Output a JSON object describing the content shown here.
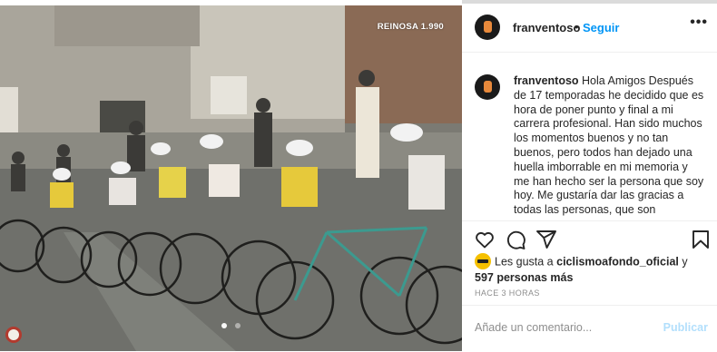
{
  "photo": {
    "watermark": "REINOSA 1.990",
    "stamp_icon": "circular-stamp-logo",
    "carousel_dots": 2
  },
  "post": {
    "username": "franventoso",
    "separator": "•",
    "follow_label": "Seguir",
    "more_label": "•••",
    "caption_user": "franventoso",
    "caption_text": "Hola Amigos Después de 17 temporadas he decidido que es hora de poner punto y final a mi carrera profesional. Han sido muchos los momentos buenos y no tan buenos, pero todos han dejado una huella imborrable en mi memoria y me han hecho ser la persona que soy hoy. Me gustaría dar las gracias a todas las personas, que son",
    "likes_prefix": "Les gusta a",
    "likes_user": "ciclismoafondo_oficial",
    "likes_and": "y",
    "likes_count": "597 personas más",
    "timestamp": "HACE 3 HORAS",
    "comment_placeholder": "Añade un comentario...",
    "publish_label": "Publicar"
  },
  "icons": [
    "heart-icon",
    "comment-icon",
    "share-icon",
    "bookmark-icon"
  ],
  "colors": {
    "accent": "#0095f6",
    "publish_disabled": "#b2dffc",
    "muted": "#8e8e8e",
    "text": "#262626"
  }
}
